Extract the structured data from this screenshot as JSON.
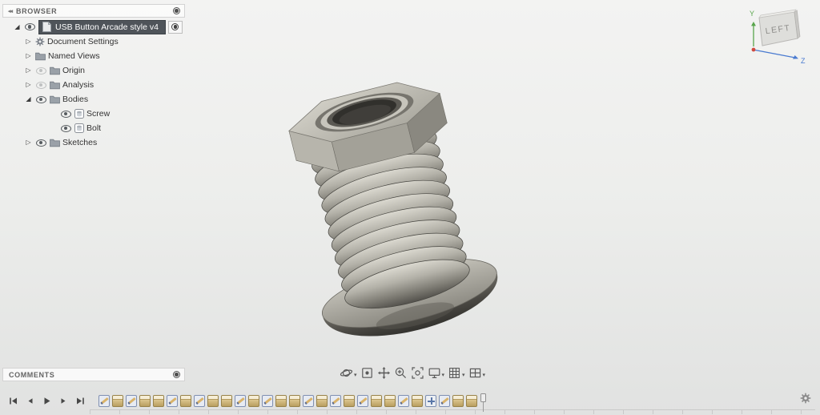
{
  "app": {
    "background": "#ececec",
    "selection_chip_color": "#4f545a"
  },
  "browser": {
    "title": "BROWSER",
    "collapse_icon": "double-left-triangle-icon",
    "header_dot_icon": "display-dot-icon",
    "root": {
      "label": "USB Button Arcade style v4",
      "expanded": true,
      "eye": "on",
      "icon": "document"
    },
    "items": [
      {
        "label": "Document Settings",
        "level": 1,
        "arrow": "collapsed",
        "eye": "none",
        "icon": "gear"
      },
      {
        "label": "Named Views",
        "level": 1,
        "arrow": "collapsed",
        "eye": "none",
        "icon": "folder"
      },
      {
        "label": "Origin",
        "level": 1,
        "arrow": "collapsed",
        "eye": "off",
        "icon": "folder"
      },
      {
        "label": "Analysis",
        "level": 1,
        "arrow": "collapsed",
        "eye": "off",
        "icon": "folder"
      },
      {
        "label": "Bodies",
        "level": 1,
        "arrow": "expanded",
        "eye": "on",
        "icon": "folder"
      },
      {
        "label": "Screw",
        "level": 2,
        "arrow": "none",
        "eye": "on",
        "icon": "body"
      },
      {
        "label": "Bolt",
        "level": 2,
        "arrow": "none",
        "eye": "on",
        "icon": "body"
      },
      {
        "label": "Sketches",
        "level": 1,
        "arrow": "collapsed",
        "eye": "on",
        "icon": "folder"
      }
    ]
  },
  "viewcube": {
    "face_label": "LEFT",
    "axis_labels": {
      "y": "Y",
      "z": "Z"
    },
    "axis_colors": {
      "x": "#cf4a3f",
      "y": "#58a54c",
      "z": "#4a7bd0"
    }
  },
  "comments": {
    "title": "COMMENTS",
    "header_dot_icon": "display-dot-icon"
  },
  "navbar": {
    "items": [
      {
        "icon": "orbit-icon",
        "caret": true
      },
      {
        "icon": "look-at-icon",
        "caret": false
      },
      {
        "icon": "pan-icon",
        "caret": false
      },
      {
        "icon": "zoom-icon",
        "caret": false
      },
      {
        "icon": "fit-icon",
        "caret": false
      },
      {
        "icon": "display-settings-icon",
        "caret": true
      },
      {
        "icon": "grid-snaps-icon",
        "caret": true
      },
      {
        "icon": "viewports-icon",
        "caret": true
      }
    ]
  },
  "timeline": {
    "controls": [
      {
        "name": "go-to-beginning"
      },
      {
        "name": "step-back"
      },
      {
        "name": "play"
      },
      {
        "name": "step-forward"
      },
      {
        "name": "go-to-end"
      }
    ],
    "features": [
      "sketch",
      "extrude",
      "sketch",
      "extrude",
      "extrude",
      "sketch",
      "extrude",
      "sketch",
      "extrude",
      "extrude",
      "sketch",
      "extrude",
      "sketch",
      "extrude",
      "extrude",
      "sketch",
      "extrude",
      "sketch",
      "extrude",
      "sketch",
      "extrude",
      "extrude",
      "sketch",
      "extrude",
      "move",
      "sketch",
      "extrude",
      "extrude"
    ],
    "icon_colors": {
      "sketch_border": "#8090b2",
      "extrude_fill": "#d8c189",
      "pencil": "#d9b36a"
    },
    "scrubber_after_feature": 28
  },
  "statusbar": {
    "settings_icon": "gear-icon"
  }
}
